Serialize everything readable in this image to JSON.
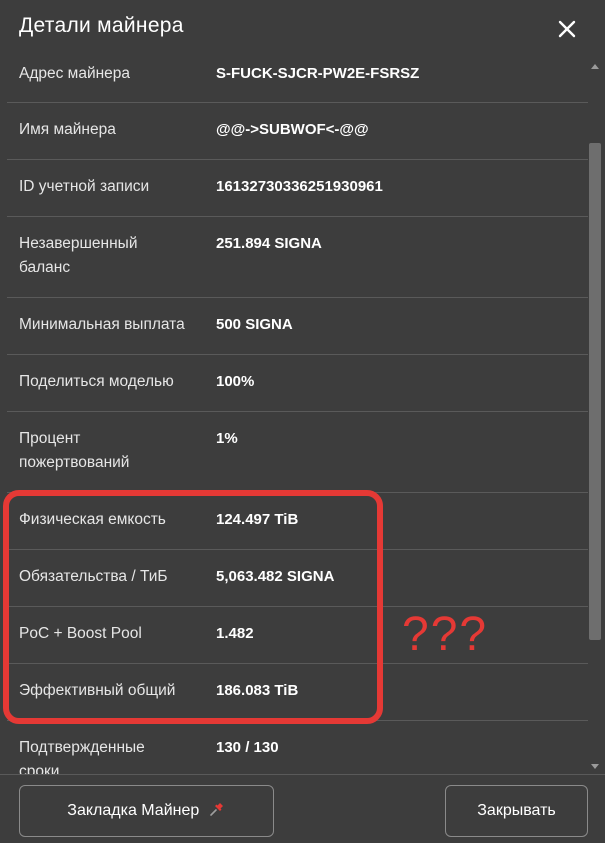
{
  "dialog": {
    "title": "Детали майнера",
    "close_icon": "close-icon"
  },
  "rows": [
    {
      "label": "Адрес майнера",
      "value": "S-FUCK-SJCR-PW2E-FSRSZ"
    },
    {
      "label": "Имя майнера",
      "value": "@@->SUBWOF<-@@"
    },
    {
      "label": "ID учетной записи",
      "value": "16132730336251930961"
    },
    {
      "label": "Незавершенный баланс",
      "value": "251.894 SIGNA"
    },
    {
      "label": "Минимальная выплата",
      "value": "500 SIGNA"
    },
    {
      "label": "Поделиться моделью",
      "value": "100%"
    },
    {
      "label": "Процент пожертвований",
      "value": "1%"
    },
    {
      "label": "Физическая емкость",
      "value": "124.497 TiB"
    },
    {
      "label": "Обязательства / ТиБ",
      "value": "5,063.482 SIGNA"
    },
    {
      "label": "PoC + Boost Pool",
      "value": "1.482"
    },
    {
      "label": "Эффективный общий",
      "value": "186.083 TiB"
    },
    {
      "label": "Подтвержденные сроки",
      "value": "130 / 130"
    }
  ],
  "footer": {
    "bookmark_label": "Закладка Майнер",
    "bookmark_icon": "pushpin-icon",
    "close_label": "Закрывать"
  },
  "annotation": {
    "text": "???",
    "color": "#e53935"
  }
}
